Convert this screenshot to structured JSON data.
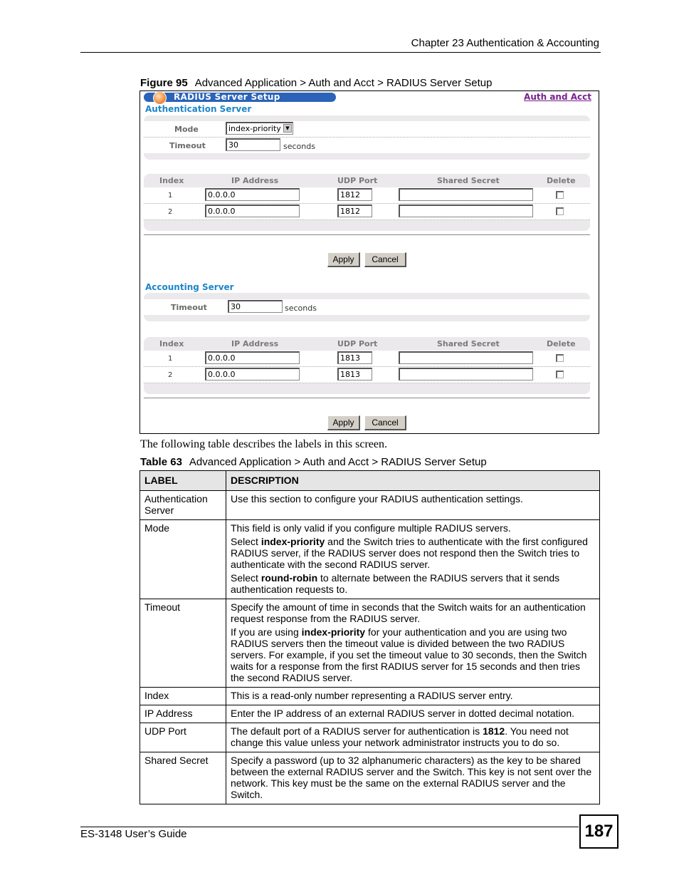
{
  "header": {
    "chapter": "Chapter 23 Authentication & Accounting"
  },
  "figure": {
    "number": "Figure 95",
    "title": "Advanced Application > Auth and Acct > RADIUS Server Setup"
  },
  "screen": {
    "title": "RADIUS Server Setup",
    "top_link": "Auth and Acct",
    "colors": {
      "title_bar": "#2a63b8",
      "section_title": "#1e86c8",
      "link": "#7a1f8f",
      "panel": "#ebe9eb"
    },
    "auth": {
      "section_title": "Authentication Server",
      "mode_label": "Mode",
      "mode_value": "index-priority",
      "timeout_label": "Timeout",
      "timeout_value": "30",
      "timeout_unit": "seconds",
      "columns": [
        "Index",
        "IP Address",
        "UDP Port",
        "Shared Secret",
        "Delete"
      ],
      "rows": [
        {
          "index": "1",
          "ip": "0.0.0.0",
          "port": "1812",
          "secret": "",
          "delete": false
        },
        {
          "index": "2",
          "ip": "0.0.0.0",
          "port": "1812",
          "secret": "",
          "delete": false
        }
      ],
      "apply_label": "Apply",
      "cancel_label": "Cancel"
    },
    "acct": {
      "section_title": "Accounting Server",
      "timeout_label": "Timeout",
      "timeout_value": "30",
      "timeout_unit": "seconds",
      "columns": [
        "Index",
        "IP Address",
        "UDP Port",
        "Shared Secret",
        "Delete"
      ],
      "rows": [
        {
          "index": "1",
          "ip": "0.0.0.0",
          "port": "1813",
          "secret": "",
          "delete": false
        },
        {
          "index": "2",
          "ip": "0.0.0.0",
          "port": "1813",
          "secret": "",
          "delete": false
        }
      ],
      "apply_label": "Apply",
      "cancel_label": "Cancel"
    }
  },
  "intro": "The following table describes the labels in this screen.",
  "table": {
    "number": "Table 63",
    "title": "Advanced Application > Auth and Acct > RADIUS Server Setup",
    "headers": [
      "LABEL",
      "DESCRIPTION"
    ],
    "rows": [
      {
        "label": "Authentication Server",
        "paras": [
          "Use this section to configure your RADIUS authentication settings."
        ]
      },
      {
        "label": "Mode",
        "paras": [
          "This field is only valid if you configure multiple RADIUS servers.",
          "Select **index-priority** and the Switch tries to authenticate with the first configured RADIUS server, if the RADIUS server does not respond then the Switch tries to authenticate with the second RADIUS server.",
          "Select **round-robin** to alternate between the RADIUS servers that it sends authentication requests to."
        ]
      },
      {
        "label": "Timeout",
        "paras": [
          "Specify the amount of time in seconds that the Switch waits for an authentication request response from the RADIUS server.",
          "If you are using **index-priority** for your authentication and you are using two RADIUS servers then the timeout value is divided between the two RADIUS servers. For example, if you set the timeout value to 30 seconds, then the Switch waits for a response from the first RADIUS server for 15 seconds and then tries the second RADIUS server."
        ]
      },
      {
        "label": "Index",
        "paras": [
          "This is a read-only number representing a RADIUS server entry."
        ]
      },
      {
        "label": "IP Address",
        "paras": [
          "Enter the IP address of an external RADIUS server in dotted decimal notation."
        ]
      },
      {
        "label": "UDP Port",
        "paras": [
          "The default port of a RADIUS server for authentication is **1812**. You need not change this value unless your network administrator instructs you to do so."
        ]
      },
      {
        "label": "Shared Secret",
        "paras": [
          "Specify a password (up to 32 alphanumeric characters) as the key to be shared between the external RADIUS server and the Switch. This key is not sent over the network. This key must be the same on the external RADIUS server and the Switch."
        ]
      }
    ]
  },
  "footer": {
    "guide": "ES-3148 User’s Guide",
    "page": "187"
  }
}
